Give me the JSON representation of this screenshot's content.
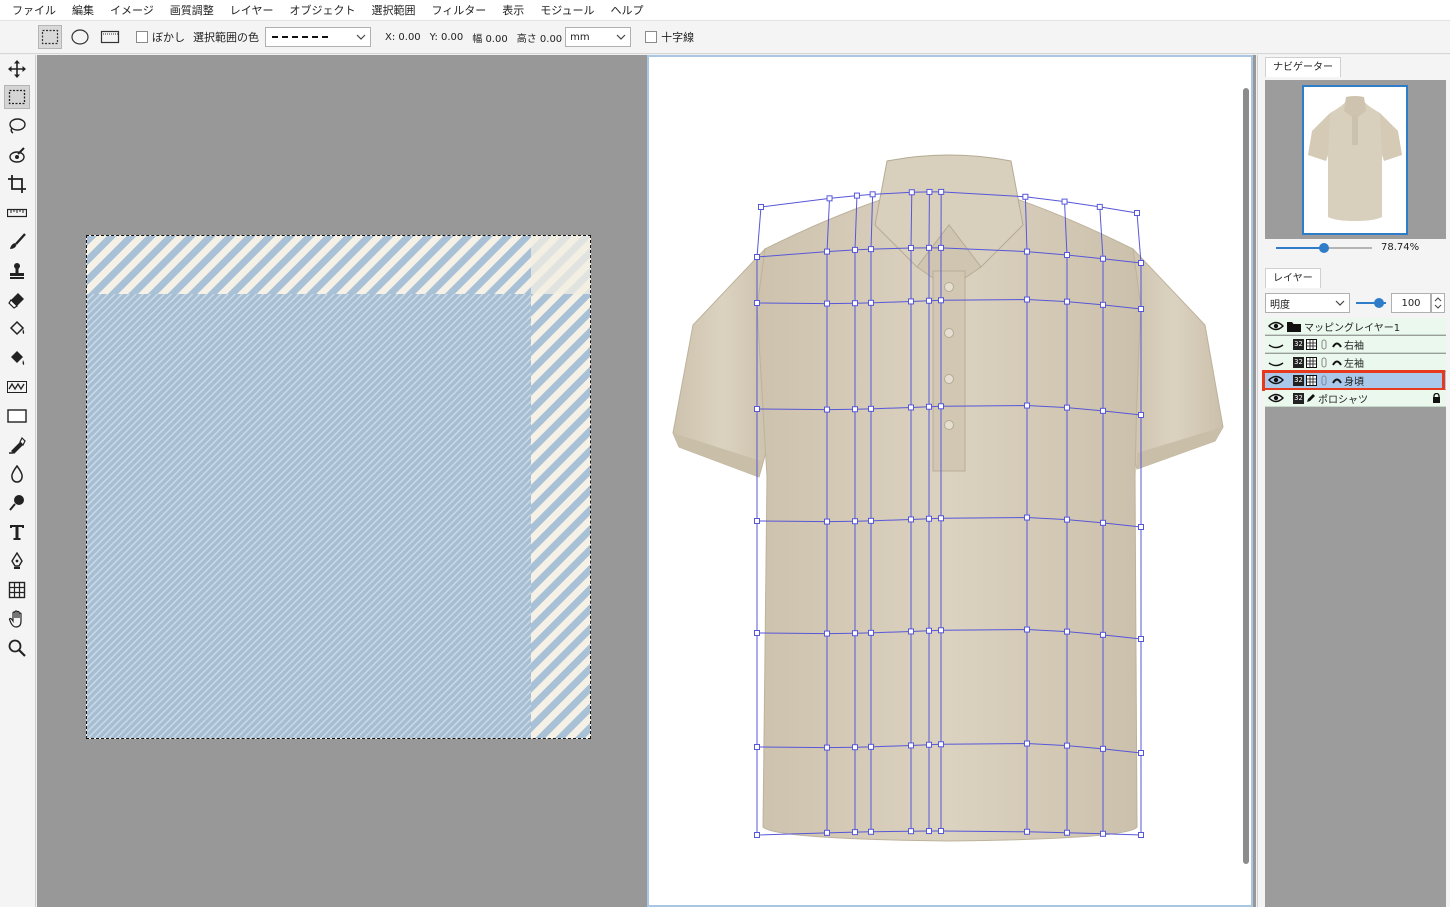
{
  "menu": [
    "ファイル",
    "編集",
    "イメージ",
    "画質調整",
    "レイヤー",
    "オブジェクト",
    "選択範囲",
    "フィルター",
    "表示",
    "モジュール",
    "ヘルプ"
  ],
  "options": {
    "blur_label": "ぼかし",
    "sel_color_label": "選択範囲の色",
    "x": "X: 0.00",
    "y": "Y: 0.00",
    "w": "幅 0.00",
    "h": "高さ 0.00",
    "unit": "mm",
    "crosshair_label": "十字線"
  },
  "tools": [
    "move-icon",
    "rect-select-icon",
    "lasso-icon",
    "eye-dropper-icon",
    "crop-icon",
    "ruler-icon",
    "brush-icon",
    "stamp-icon",
    "eraser-icon",
    "fill-icon",
    "gradient-icon",
    "smudge-icon",
    "shape-icon",
    "pen-edit-icon",
    "blur-drop-icon",
    "dodge-icon",
    "text-icon",
    "pen-icon",
    "mesh-icon",
    "hand-icon",
    "zoom-icon"
  ],
  "navigator": {
    "tab": "ナビゲーター",
    "zoom": "78.74%",
    "zoom_fraction": 0.5
  },
  "layers": {
    "tab": "レイヤー",
    "blend_mode": "明度",
    "opacity": "100",
    "items": [
      {
        "name": "マッピングレイヤー1",
        "kind": "folder",
        "visible": true,
        "selected": false
      },
      {
        "name": "右袖",
        "kind": "mapped",
        "visible": false,
        "selected": false
      },
      {
        "name": "左袖",
        "kind": "mapped",
        "visible": false,
        "selected": false
      },
      {
        "name": "身頃",
        "kind": "mapped",
        "visible": true,
        "selected": true
      },
      {
        "name": "ポロシャツ",
        "kind": "image",
        "visible": true,
        "selected": false,
        "locked": true
      }
    ]
  },
  "colors": {
    "texture_blue": "#a6bed3",
    "texture_stripe": "#f5f1e7",
    "mesh": "#5757d9",
    "accent": "#2f7dc8",
    "selection_outline": "#e53a1d",
    "shirt": "#d6ccb9"
  }
}
